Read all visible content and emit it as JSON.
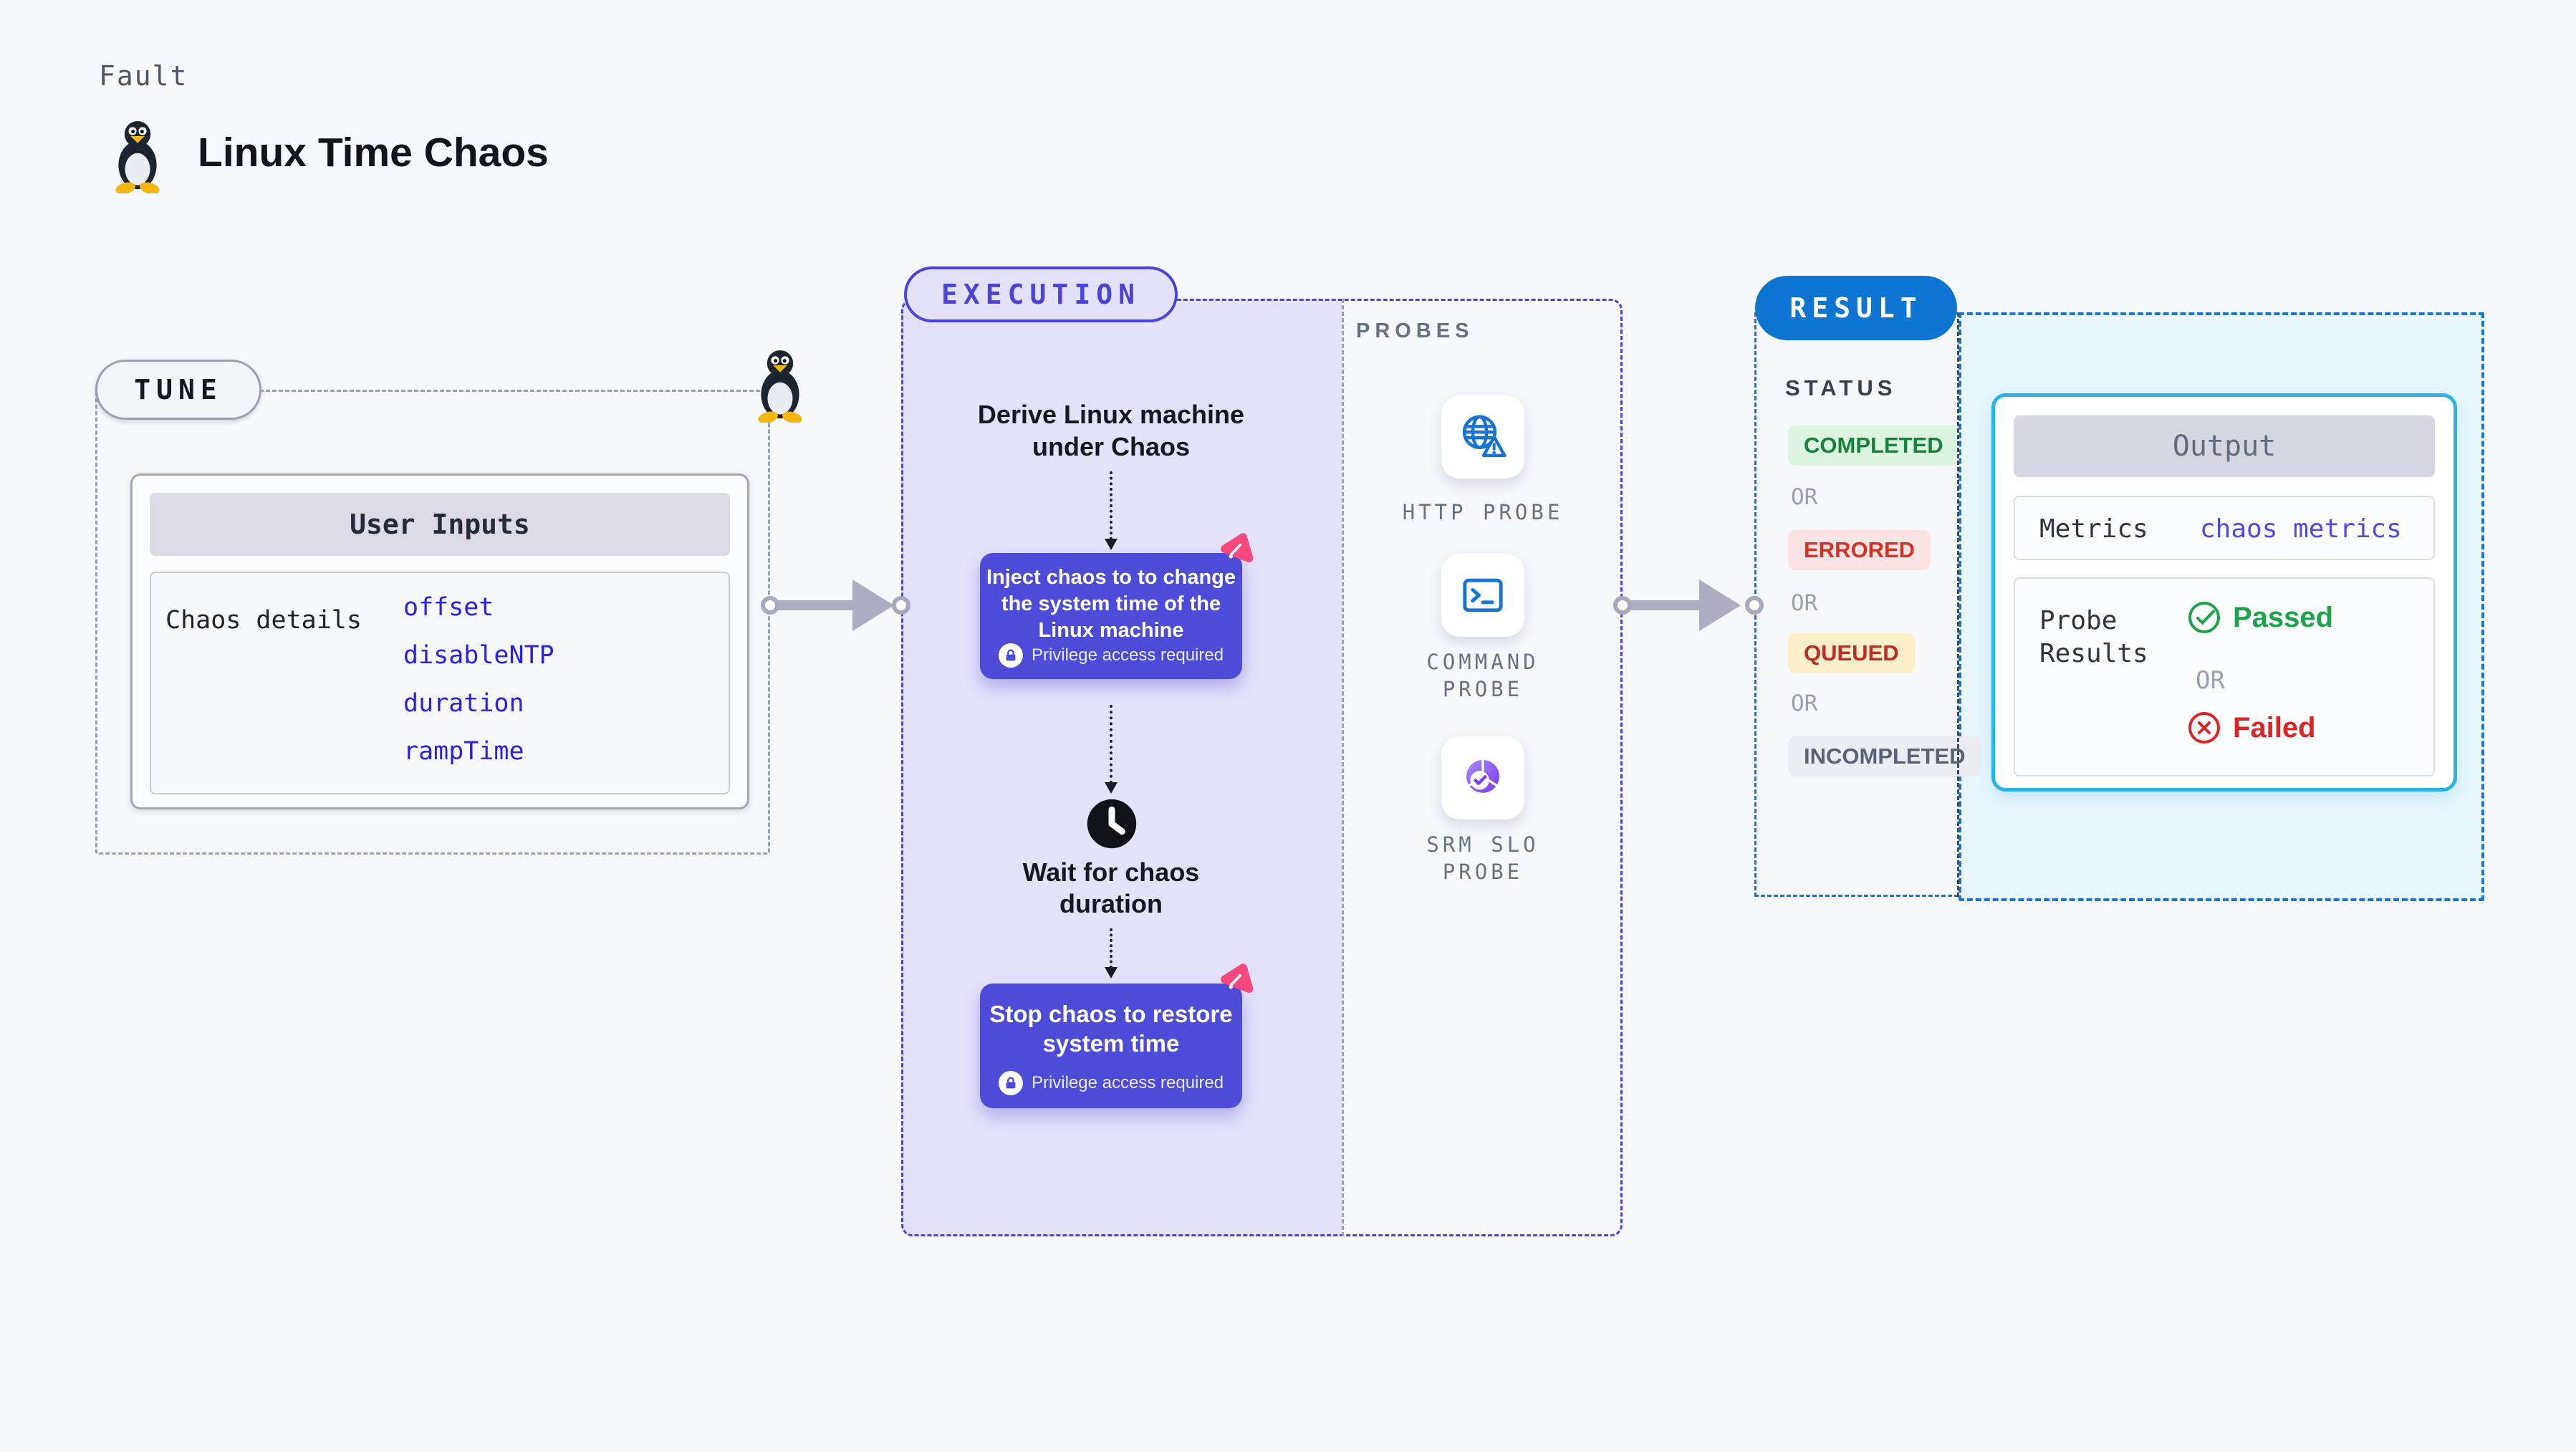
{
  "header": {
    "eyebrow": "Fault",
    "title": "Linux Time Chaos"
  },
  "tune": {
    "badge": "TUNE",
    "user_inputs": {
      "title": "User Inputs",
      "row_label": "Chaos details",
      "values": [
        "offset",
        "disableNTP",
        "duration",
        "rampTime"
      ]
    }
  },
  "execution": {
    "badge": "EXECUTION",
    "derive_text": "Derive Linux machine under Chaos",
    "inject_text": "Inject chaos to to change the system time of the Linux machine",
    "privilege_note": "Privilege access required",
    "wait_text": "Wait for chaos duration",
    "stop_text": "Stop chaos to restore system time"
  },
  "probes": {
    "label": "PROBES",
    "items": [
      {
        "name": "http-probe",
        "label": "HTTP PROBE"
      },
      {
        "name": "command-probe",
        "label": "COMMAND PROBE"
      },
      {
        "name": "srm-slo-probe",
        "label": "SRM SLO PROBE"
      }
    ]
  },
  "result": {
    "badge": "RESULT",
    "status_label": "STATUS",
    "or_label": "OR",
    "statuses": [
      {
        "label": "COMPLETED",
        "color": "#178239",
        "bg": "#DCF5E1"
      },
      {
        "label": "ERRORED",
        "color": "#D93025",
        "bg": "#FBE4E3"
      },
      {
        "label": "QUEUED",
        "color": "#BE2C24",
        "bg": "#FAEFC8"
      },
      {
        "label": "INCOMPLETED",
        "color": "#5B6273",
        "bg": "#ECEDF3"
      }
    ],
    "output": {
      "title": "Output",
      "metrics_label": "Metrics",
      "metrics_value": "chaos metrics",
      "probe_results_label": "Probe Results",
      "or_label": "OR",
      "passed_label": "Passed",
      "failed_label": "Failed"
    }
  },
  "colors": {
    "page_bg": "#F7F8FB",
    "accent_indigo": "#4B43DB",
    "chaos_box_purple": "#4F4BD9",
    "chaos_brand_pink": "#F8487E",
    "result_badge_blue": "#0E75D3",
    "output_border_cyan": "#29B2E8",
    "probe_icon_blue": "#1774D1",
    "srm_icon_purple": "#7C3AED",
    "passed_green": "#1CA24B",
    "failed_red": "#DC2626",
    "execution_bg": "#E4E2F9",
    "result_bg": "#E8F6FD"
  }
}
